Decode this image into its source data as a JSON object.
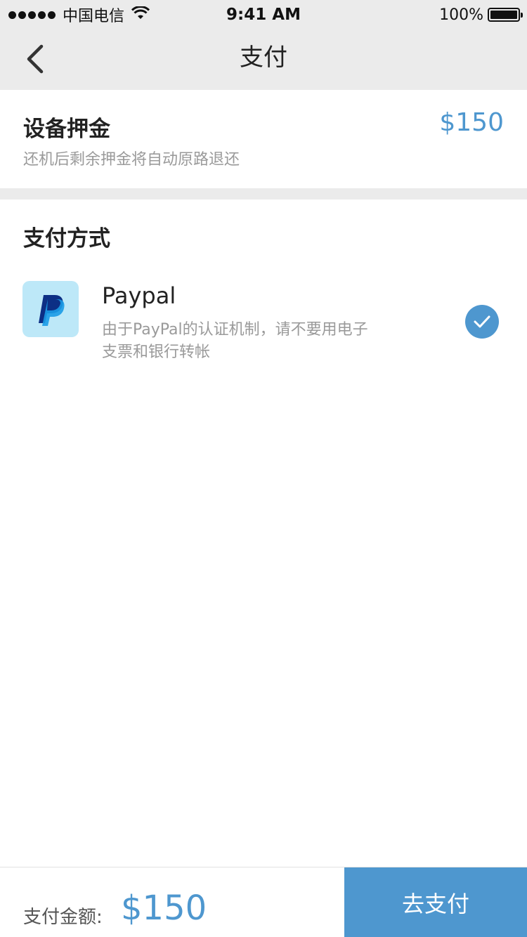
{
  "status_bar": {
    "carrier": "中国电信",
    "time": "9:41 AM",
    "battery": "100%"
  },
  "nav": {
    "title": "支付",
    "back_icon": "chevron-left-icon"
  },
  "deposit": {
    "title": "设备押金",
    "amount": "$150",
    "note": "还机后剩余押金将自动原路退还"
  },
  "payment_methods": {
    "title": "支付方式",
    "items": [
      {
        "name": "Paypal",
        "description": "由于PayPal的认证机制，请不要用电子支票和银行转帐",
        "icon": "paypal-icon",
        "selected": true
      }
    ]
  },
  "footer": {
    "total_label": "支付金额:",
    "total_amount": "$150",
    "pay_button": "去支付"
  },
  "colors": {
    "accent": "#4e97cf",
    "background_gray": "#ebebeb",
    "paypal_tile": "#bde8f8"
  }
}
